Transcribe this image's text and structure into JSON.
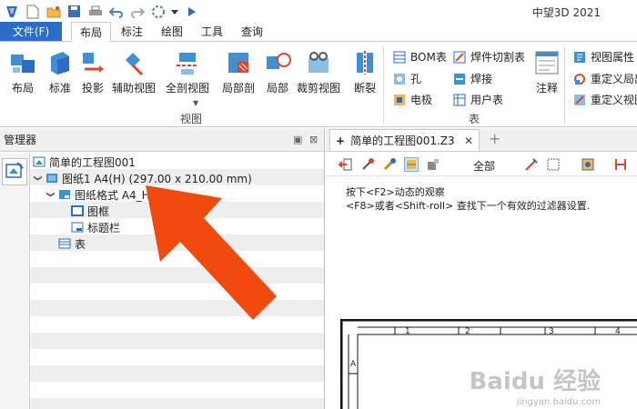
{
  "app": {
    "title": "中望3D 2021"
  },
  "quick_access": [
    "app-logo-icon",
    "new-file-icon",
    "open-folder-icon",
    "save-icon",
    "print-icon",
    "undo-icon",
    "redo-icon",
    "selection-icon",
    "dropdown-icon",
    "run-icon"
  ],
  "menu": {
    "file": "文件(F)",
    "tabs": [
      "布局",
      "标注",
      "绘图",
      "工具",
      "查询"
    ],
    "active_index": 0
  },
  "ribbon": {
    "view_group": {
      "label": "视图",
      "buttons": [
        "布局",
        "标准",
        "投影",
        "辅助视图",
        "全剖视图",
        "局部剖",
        "局部",
        "裁剪视图",
        "断裂"
      ]
    },
    "table_group": {
      "label": "表",
      "items": [
        "BOM表",
        "孔",
        "电极",
        "焊件切割表",
        "焊接",
        "用户表"
      ],
      "annotate": "注释"
    },
    "props_group": {
      "items": [
        "视图属性",
        "重定义局部",
        "重定义视图"
      ]
    }
  },
  "manager": {
    "title": "管理器",
    "tree": [
      {
        "label": "简单的工程图001",
        "level": 0,
        "expand": ""
      },
      {
        "label": "图纸1 A4(H) (297.00 x 210.00 mm)",
        "level": 0,
        "expand": "v"
      },
      {
        "label": "图纸格式 A4_H(DIN)",
        "level": 1,
        "expand": "v"
      },
      {
        "label": "图框",
        "level": 2,
        "expand": ""
      },
      {
        "label": "标题栏",
        "level": 2,
        "expand": ""
      },
      {
        "label": "表",
        "level": 1,
        "expand": ""
      }
    ]
  },
  "doc": {
    "tab_label": "简单的工程图001.Z3",
    "filter_label": "全部",
    "hint_line1": "按下<F2>动态的观察",
    "hint_line2": "<F8>或者<Shift-roll> 查找下一个有效的过滤器设置.",
    "ruler": [
      "1",
      "2",
      "3",
      "4"
    ],
    "row_mark": "A"
  },
  "watermark": {
    "main": "Baidu 经验",
    "sub": "jingyan.baidu.com"
  },
  "colors": {
    "accent": "#2b6cc4",
    "arrow": "#f04a0c"
  }
}
